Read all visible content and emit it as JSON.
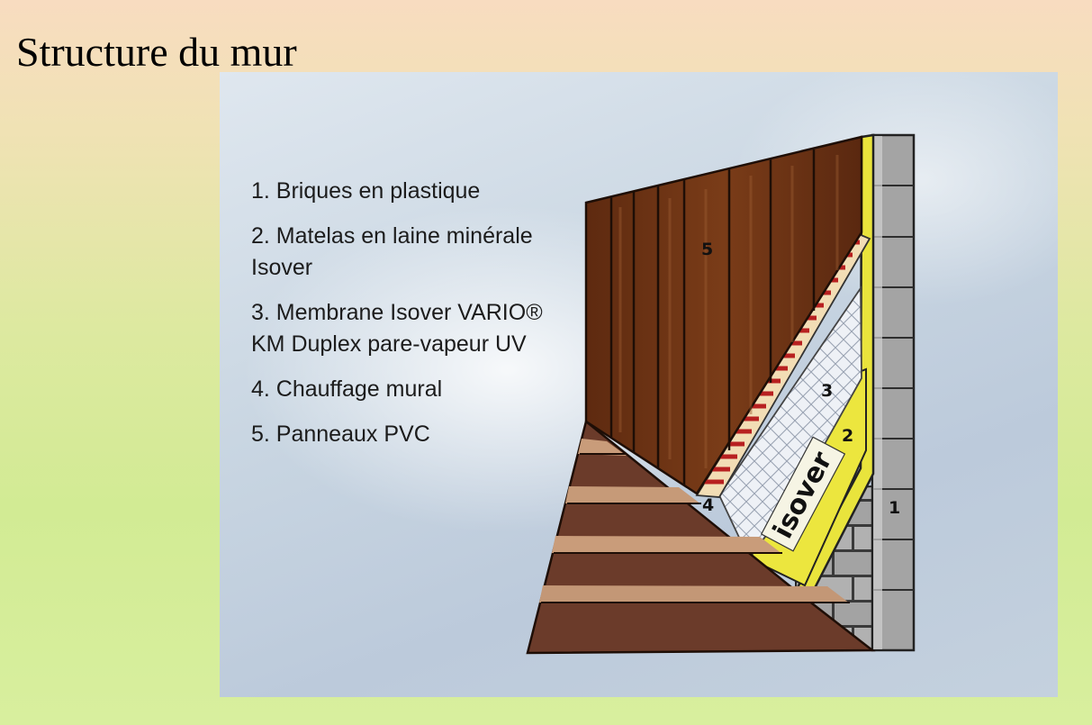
{
  "page": {
    "title": "Structure du mur"
  },
  "legend": {
    "items": [
      {
        "number": "1",
        "text": "1. Briques en plastique"
      },
      {
        "number": "2",
        "text": "2. Matelas en laine minérale Isover"
      },
      {
        "number": "3",
        "text": "3. Membrane Isover VARIO® KM Duplex pare-vapeur UV"
      },
      {
        "number": "4",
        "text": "4. Chauffage mural"
      },
      {
        "number": "5",
        "text": "5. Panneaux PVC"
      }
    ]
  },
  "diagram": {
    "callouts": {
      "bricks": "1",
      "insulation": "2",
      "membrane": "3",
      "heating": "4",
      "panels": "5"
    },
    "logo_text": "isover",
    "colors": {
      "panel_wood": "#6e3416",
      "floor_dark": "#6a3a2a",
      "floor_light": "#c79a78",
      "insulation_yellow": "#e6e23a",
      "brick_gray": "#9f9f9f",
      "heating_red": "#b82020"
    }
  }
}
